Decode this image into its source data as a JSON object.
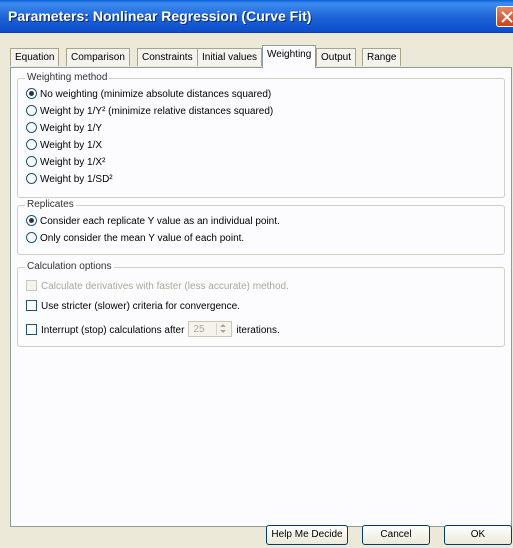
{
  "window": {
    "title": "Parameters: Nonlinear Regression (Curve Fit)"
  },
  "tabs": [
    {
      "label": "Equation"
    },
    {
      "label": "Comparison"
    },
    {
      "label": "Constraints"
    },
    {
      "label": "Initial values"
    },
    {
      "label": "Weighting",
      "active": true
    },
    {
      "label": "Output"
    },
    {
      "label": "Range"
    }
  ],
  "weighting_method": {
    "legend": "Weighting method",
    "selected": 0,
    "options": [
      "No weighting (minimize absolute distances squared)",
      "Weight by 1/Y² (minimize relative distances squared)",
      "Weight by 1/Y",
      "Weight by 1/X",
      "Weight by 1/X²",
      "Weight by 1/SD²"
    ]
  },
  "replicates": {
    "legend": "Replicates",
    "selected": 0,
    "options": [
      "Consider each replicate Y value as an individual point.",
      "Only consider the mean Y value of each point."
    ]
  },
  "calculation_options": {
    "legend": "Calculation options",
    "derivatives_label": "Calculate derivatives with faster (less accurate) method.",
    "stricter_label": "Use stricter (slower) criteria for convergence.",
    "interrupt_label_before": "Interrupt (stop) calculations after",
    "interrupt_value": "25",
    "interrupt_label_after": "iterations."
  },
  "buttons": {
    "help_label": "Help Me Decide",
    "cancel_label": "Cancel",
    "ok_label": "OK"
  }
}
